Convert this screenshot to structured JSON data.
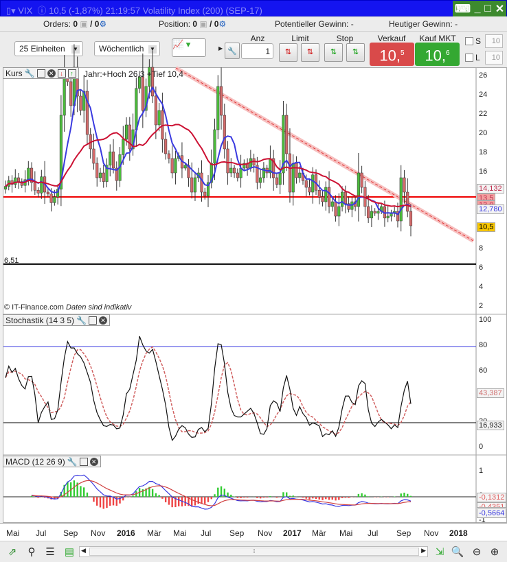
{
  "title": {
    "symbol": "VIX",
    "quote": "10,5 (-1,87%)",
    "time": "21:19:57",
    "name": "Volatility Index (200) (SEP-17)"
  },
  "info": {
    "orders_label": "Orders:",
    "orders_value": "0",
    "orders_total": "/ 0",
    "position_label": "Position:",
    "position_value": "0",
    "position_total": "/ 0",
    "pot_gain_label": "Potentieller Gewinn:",
    "pot_gain_value": "-",
    "today_gain_label": "Heutiger Gewinn:",
    "today_gain_value": "-"
  },
  "toolbar": {
    "units": "25 Einheiten",
    "period": "Wöchentlich",
    "anz_label": "Anz",
    "anz_value": "1",
    "limit_label": "Limit",
    "stop_label": "Stop",
    "sell_label": "Verkauf MKT",
    "sell_price": "10,",
    "sell_frac": "5",
    "buy_label": "Kauf MKT",
    "buy_price": "10,",
    "buy_frac": "6",
    "s_label": "S",
    "s_value": "10",
    "l_label": "L",
    "l_value": "10"
  },
  "colors": {
    "sell": "#d94a4a",
    "buy": "#34a832",
    "up": "#4cbb3c",
    "down": "#d26a6a",
    "ma_fast": "#3a3ae0",
    "ma_slow": "#cc1133"
  },
  "price_panel": {
    "legend": "Kurs",
    "info": "Jahr:+Hoch 26,3 +Tief 10,4",
    "credit": "© IT-Finance.com",
    "credit_note": "Daten sind indikativ",
    "level_label": "6,51",
    "tags": {
      "ma_slow": "14,132",
      "line1": "13,5",
      "line2": "13,0",
      "ma_fast": "12,780",
      "last": "10,5"
    },
    "yticks": [
      "26",
      "24",
      "22",
      "20",
      "18",
      "16",
      "14",
      "12",
      "10",
      "8",
      "6",
      "4",
      "2"
    ]
  },
  "stoch_panel": {
    "legend": "Stochastik (14 3 5)",
    "yticks": [
      "100",
      "80",
      "60",
      "40",
      "20",
      "0"
    ],
    "tags": {
      "d": "43,387",
      "k": "16,933"
    }
  },
  "macd_panel": {
    "legend": "MACD (12 26 9)",
    "yticks": [
      "1",
      "0",
      "-1"
    ],
    "tags": {
      "signal": "-0,1312",
      "hist": "-0,4351",
      "macd": "-0,5664"
    }
  },
  "xaxis": [
    "Mai",
    "Jul",
    "Sep",
    "Nov",
    "2016",
    "Mär",
    "Mai",
    "Jul",
    "Sep",
    "Nov",
    "2017",
    "Mär",
    "Mai",
    "Jul",
    "Sep",
    "Nov",
    "2018"
  ],
  "chart_data": {
    "type": "candlestick",
    "interval": "weekly",
    "ylim": [
      2,
      27
    ],
    "hline": 6.51,
    "resistance": 13.5,
    "closes": [
      14.6,
      15.2,
      14.8,
      15.5,
      15.1,
      14.7,
      15.3,
      16.5,
      15.0,
      14.2,
      13.9,
      15.6,
      14.0,
      13.8,
      12.9,
      13.5,
      14.3,
      22.0,
      26.0,
      25.5,
      23.0,
      27.0,
      24.0,
      22.5,
      24.5,
      20.0,
      18.5,
      17.0,
      15.5,
      16.0,
      15.1,
      16.8,
      18.2,
      16.5,
      15.2,
      17.9,
      19.5,
      21.0,
      18.5,
      20.5,
      24.8,
      26.0,
      22.5,
      25.0,
      27.0,
      24.0,
      21.0,
      22.5,
      19.5,
      18.0,
      17.5,
      16.0,
      17.5,
      17.8,
      16.5,
      16.8,
      15.5,
      14.0,
      15.5,
      16.0,
      14.0,
      13.6,
      15.0,
      17.0,
      20.5,
      25.0,
      22.0,
      18.5,
      16.0,
      16.5,
      16.0,
      15.5,
      16.5,
      17.0,
      16.5,
      17.5,
      16.8,
      15.0,
      15.5,
      16.5,
      16.0,
      17.5,
      15.5,
      14.8,
      16.0,
      22.0,
      18.0,
      14.0,
      17.0,
      15.5,
      16.0,
      15.2,
      14.5,
      14.0,
      15.8,
      14.2,
      13.5,
      13.0,
      14.5,
      12.5,
      13.0,
      11.5,
      12.5,
      14.0,
      12.8,
      12.2,
      13.0,
      12.5,
      16.0,
      14.5,
      12.5,
      11.3,
      12.0,
      11.8,
      12.0,
      12.5,
      11.3,
      11.5,
      11.8,
      12.0,
      11.0,
      15.5,
      14.0,
      12.0,
      10.5
    ]
  }
}
